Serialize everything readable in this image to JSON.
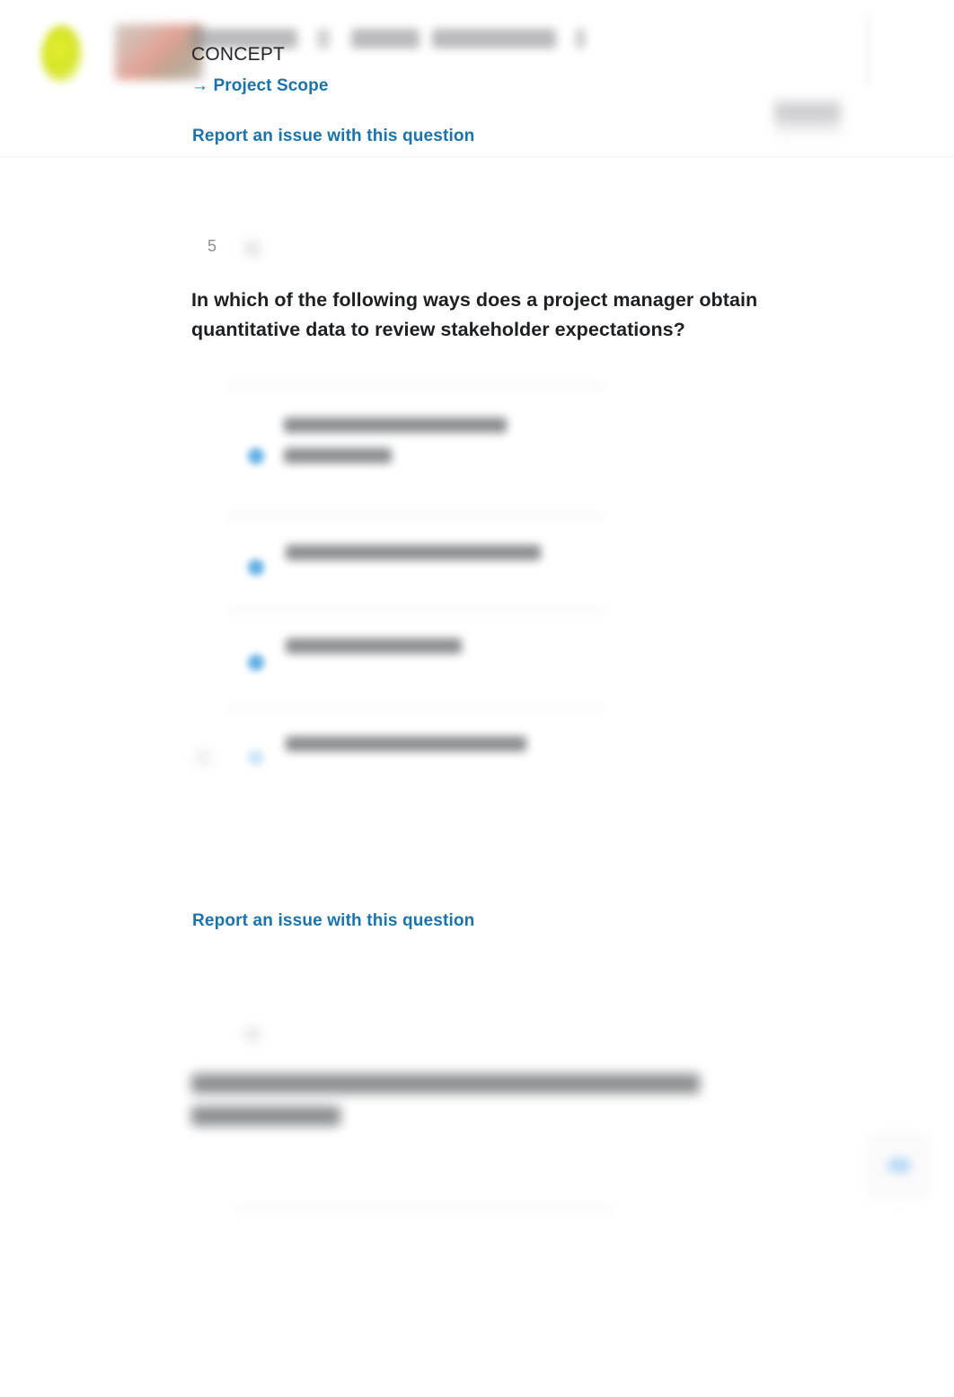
{
  "header": {
    "logo_icon": "leaf-logo-icon",
    "course_thumbnail": "course-thumbnail-image",
    "title_redacted": true,
    "concept_label": "CONCEPT",
    "breadcrumb": "→ Project Scope",
    "report_link": "Report an issue with this question",
    "badge_redacted": true
  },
  "question": {
    "number": "5",
    "meta_icon": "question-meta-icon",
    "text": "In which of the following ways does a project manager obtain quantitative data to review stakeholder expectations?",
    "options": [
      {
        "id": "option-a",
        "radio_icon": "radio-button-icon",
        "selected": false,
        "redacted": true,
        "line_widths": [
          248,
          120
        ],
        "lines": 2
      },
      {
        "id": "option-b",
        "radio_icon": "radio-button-icon",
        "selected": false,
        "redacted": true,
        "line_widths": [
          284
        ],
        "lines": 1
      },
      {
        "id": "option-c",
        "radio_icon": "radio-button-icon",
        "selected": false,
        "redacted": true,
        "line_widths": [
          196
        ],
        "lines": 1
      },
      {
        "id": "option-d",
        "radio_icon": "radio-button-icon",
        "selected": false,
        "redacted": true,
        "has_prefix_mark": true,
        "line_widths": [
          268
        ],
        "lines": 1
      }
    ]
  },
  "footer": {
    "report_link": "Report an issue with this question"
  },
  "next_question": {
    "meta_icon": "question-meta-icon",
    "redacted": true,
    "line_widths": [
      566,
      166
    ],
    "lines": 2
  },
  "help_widget": {
    "icon": "help-chat-icon",
    "redacted": true
  },
  "colors": {
    "link": "#1b73ab",
    "question_text": "#1d2023",
    "muted": "#8c9094",
    "radio_blue": "#4aa3e0",
    "background": "#ffffff",
    "logo_green": "#d4e425"
  }
}
